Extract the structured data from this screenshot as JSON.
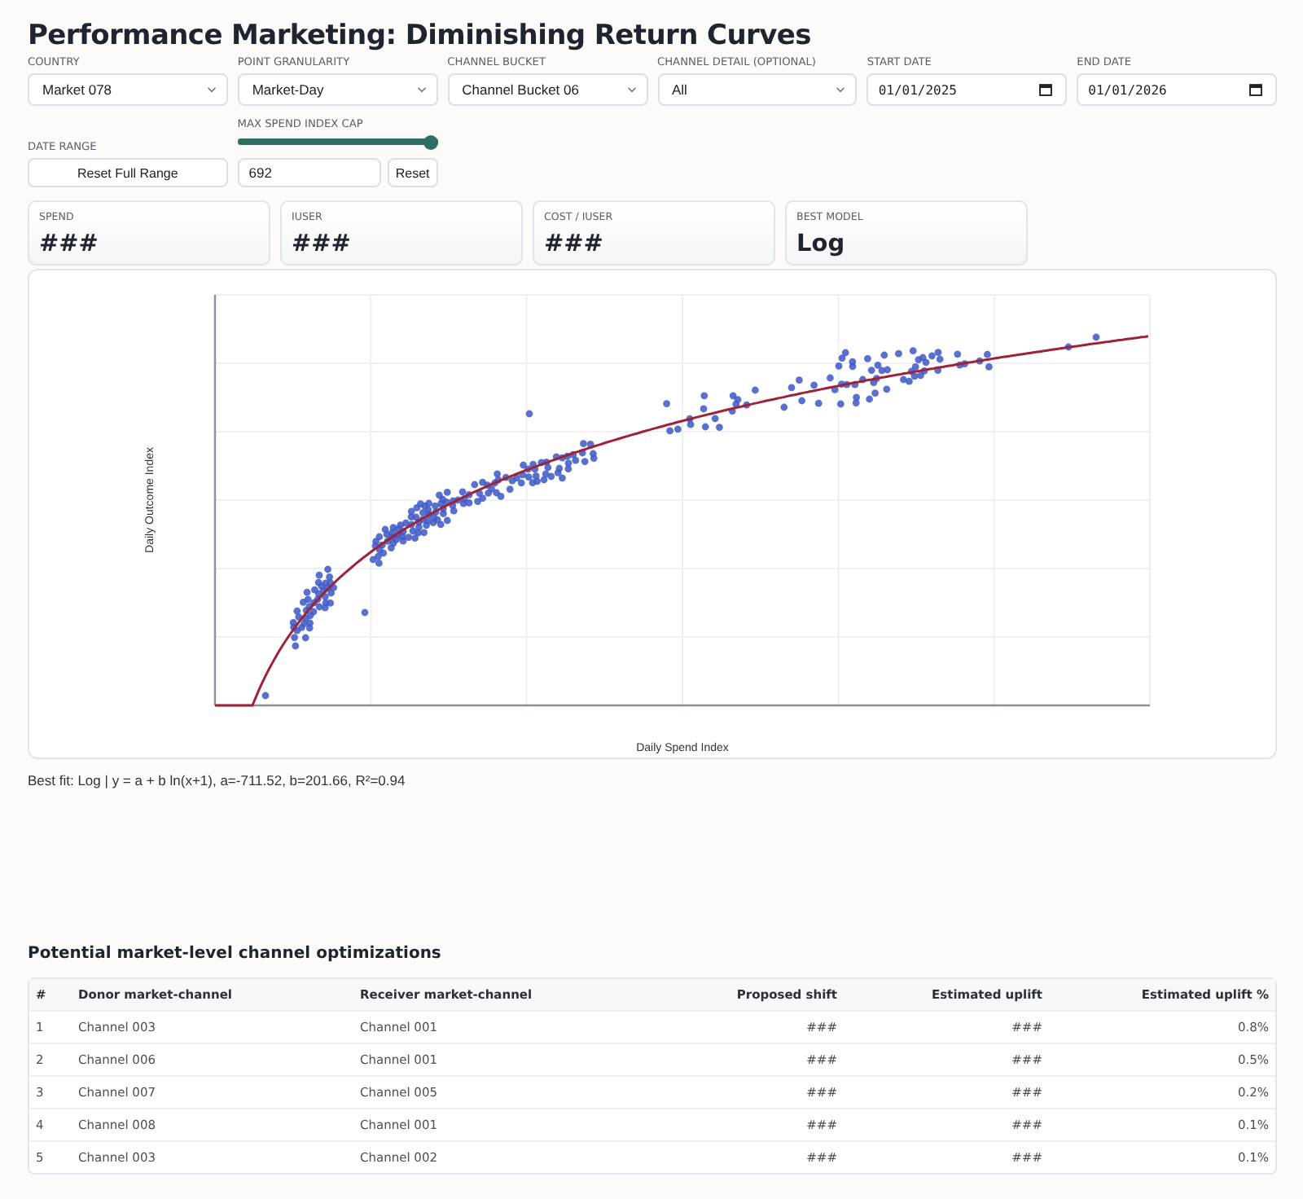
{
  "title": "Performance Marketing: Diminishing Return Curves",
  "filters": [
    {
      "kind": "select",
      "label": "COUNTRY",
      "value": "Market 078"
    },
    {
      "kind": "select",
      "label": "POINT GRANULARITY",
      "value": "Market-Day"
    },
    {
      "kind": "select",
      "label": "CHANNEL BUCKET",
      "value": "Channel Bucket 06"
    },
    {
      "kind": "select",
      "label": "CHANNEL DETAIL (OPTIONAL)",
      "value": "All"
    },
    {
      "kind": "date",
      "label": "START DATE",
      "value": "01/01/2025"
    },
    {
      "kind": "date",
      "label": "END DATE",
      "value": "01/01/2026"
    }
  ],
  "date_range": {
    "label": "DATE RANGE",
    "button": "Reset Full Range"
  },
  "spend_cap": {
    "label": "MAX SPEND INDEX CAP",
    "level": 1,
    "value": "692",
    "button": "Reset"
  },
  "kpis": [
    {
      "label": "SPEND",
      "value": "###"
    },
    {
      "label": "IUSER",
      "value": "###"
    },
    {
      "label": "COST / IUSER",
      "value": "###"
    },
    {
      "label": "BEST MODEL",
      "value": "Log"
    }
  ],
  "chart": {
    "x_axis_title": "Daily Spend Index",
    "y_axis_title": "Daily Outcome Index"
  },
  "fit_summary": "Best fit: Log | y = a + b ln(x+1), a=-711.52, b=201.66, R²=0.94",
  "optimizations": {
    "title": "Potential market-level channel optimizations",
    "columns": [
      {
        "label": "#",
        "kind": "text"
      },
      {
        "label": "Donor market-channel",
        "kind": "text"
      },
      {
        "label": "Receiver market-channel",
        "kind": "text"
      },
      {
        "label": "Proposed shift",
        "kind": "number"
      },
      {
        "label": "Estimated uplift",
        "kind": "number"
      },
      {
        "label": "Estimated uplift %",
        "kind": "number"
      }
    ],
    "rows": [
      [
        "1",
        "Channel 003",
        "Channel 001",
        "###",
        "###",
        "0.8%"
      ],
      [
        "2",
        "Channel 006",
        "Channel 001",
        "###",
        "###",
        "0.5%"
      ],
      [
        "3",
        "Channel 007",
        "Channel 005",
        "###",
        "###",
        "0.2%"
      ],
      [
        "4",
        "Channel 008",
        "Channel 001",
        "###",
        "###",
        "0.1%"
      ],
      [
        "5",
        "Channel 003",
        "Channel 002",
        "###",
        "###",
        "0.1%"
      ]
    ]
  }
}
